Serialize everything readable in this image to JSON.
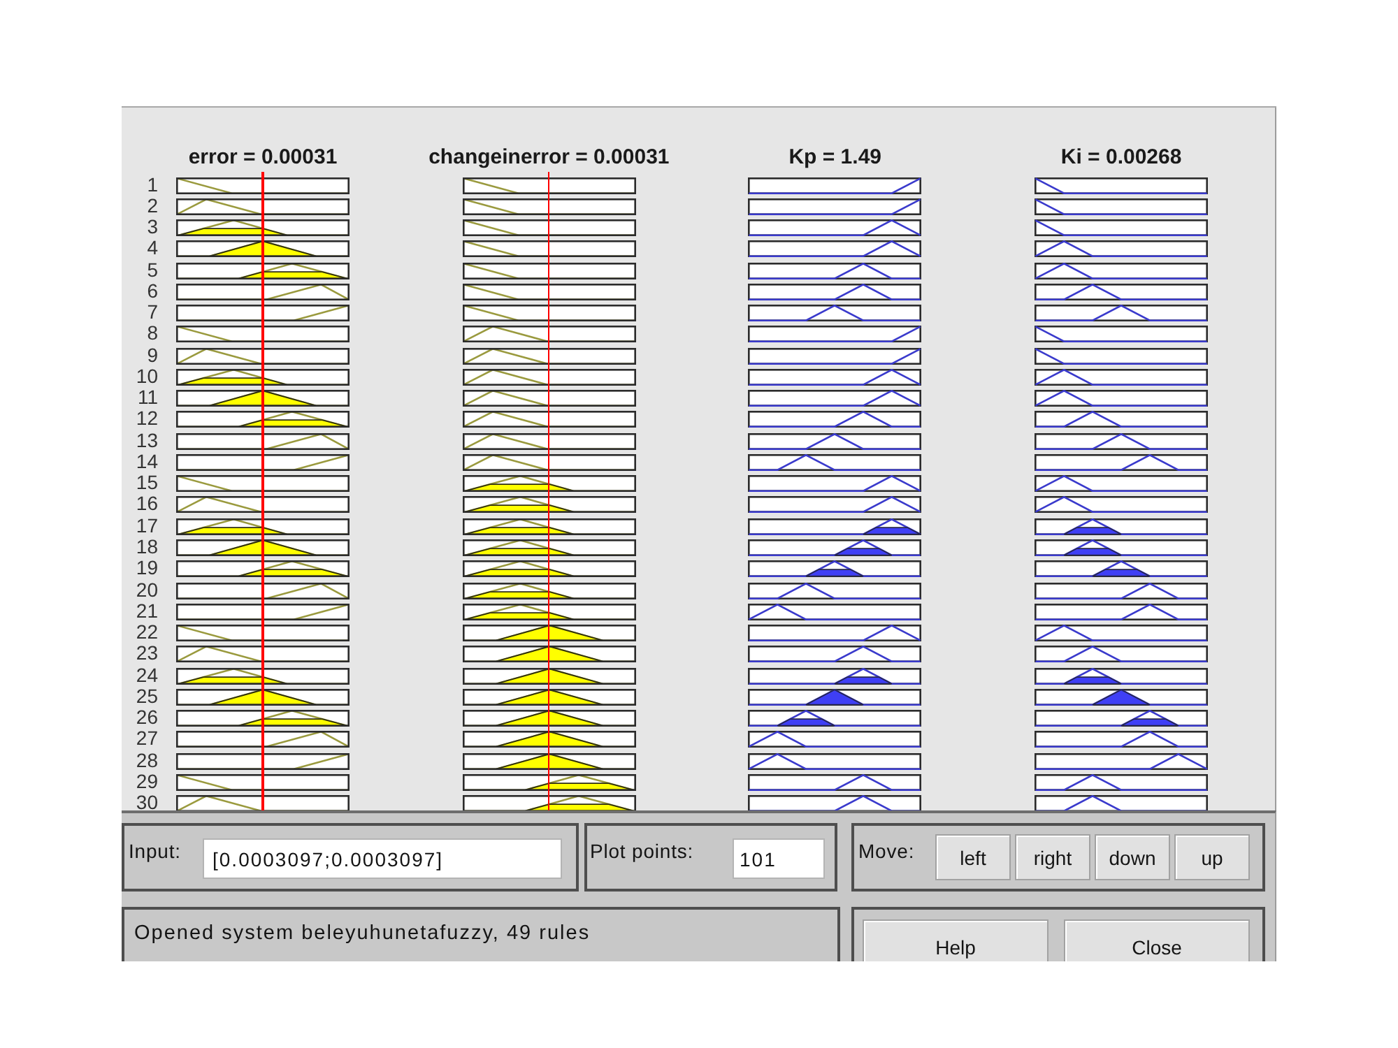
{
  "columns": [
    {
      "kind": "input",
      "title": "error = 0.00031",
      "level": 0.5
    },
    {
      "kind": "input",
      "title": "changeinerror = 0.00031",
      "level": 0.5
    },
    {
      "kind": "output",
      "title": "Kp = 1.49"
    },
    {
      "kind": "output",
      "title": "Ki = 0.00268"
    }
  ],
  "rules": [
    {
      "number": "1",
      "cells": [
        {
          "kind": "mf1"
        },
        {
          "kind": "mf1"
        },
        {
          "kind": "mf7"
        },
        {
          "kind": "mf1"
        }
      ]
    },
    {
      "number": "2",
      "cells": [
        {
          "kind": "mf2"
        },
        {
          "kind": "mf1"
        },
        {
          "kind": "mf7"
        },
        {
          "kind": "mf1"
        }
      ]
    },
    {
      "number": "3",
      "cells": [
        {
          "kind": "mf3"
        },
        {
          "kind": "mf1"
        },
        {
          "kind": "mf6"
        },
        {
          "kind": "mf1"
        }
      ]
    },
    {
      "number": "4",
      "cells": [
        {
          "kind": "mf4"
        },
        {
          "kind": "mf1"
        },
        {
          "kind": "mf6"
        },
        {
          "kind": "mf2"
        }
      ]
    },
    {
      "number": "5",
      "cells": [
        {
          "kind": "mf5"
        },
        {
          "kind": "mf1"
        },
        {
          "kind": "mf5"
        },
        {
          "kind": "mf2"
        }
      ]
    },
    {
      "number": "6",
      "cells": [
        {
          "kind": "mf6"
        },
        {
          "kind": "mf1"
        },
        {
          "kind": "mf5"
        },
        {
          "kind": "mf3"
        }
      ]
    },
    {
      "number": "7",
      "cells": [
        {
          "kind": "mf7"
        },
        {
          "kind": "mf1"
        },
        {
          "kind": "mf4"
        },
        {
          "kind": "mf4"
        }
      ]
    },
    {
      "number": "8",
      "cells": [
        {
          "kind": "mf1"
        },
        {
          "kind": "mf2"
        },
        {
          "kind": "mf7"
        },
        {
          "kind": "mf1"
        }
      ]
    },
    {
      "number": "9",
      "cells": [
        {
          "kind": "mf2"
        },
        {
          "kind": "mf2"
        },
        {
          "kind": "mf7"
        },
        {
          "kind": "mf1"
        }
      ]
    },
    {
      "number": "10",
      "cells": [
        {
          "kind": "mf3"
        },
        {
          "kind": "mf2"
        },
        {
          "kind": "mf6"
        },
        {
          "kind": "mf2"
        }
      ]
    },
    {
      "number": "11",
      "cells": [
        {
          "kind": "mf4"
        },
        {
          "kind": "mf2"
        },
        {
          "kind": "mf6"
        },
        {
          "kind": "mf2"
        }
      ]
    },
    {
      "number": "12",
      "cells": [
        {
          "kind": "mf5"
        },
        {
          "kind": "mf2"
        },
        {
          "kind": "mf5"
        },
        {
          "kind": "mf3"
        }
      ]
    },
    {
      "number": "13",
      "cells": [
        {
          "kind": "mf6"
        },
        {
          "kind": "mf2"
        },
        {
          "kind": "mf4"
        },
        {
          "kind": "mf4"
        }
      ]
    },
    {
      "number": "14",
      "cells": [
        {
          "kind": "mf7"
        },
        {
          "kind": "mf2"
        },
        {
          "kind": "mf3"
        },
        {
          "kind": "mf5"
        }
      ]
    },
    {
      "number": "15",
      "cells": [
        {
          "kind": "mf1"
        },
        {
          "kind": "mf3"
        },
        {
          "kind": "mf6"
        },
        {
          "kind": "mf2"
        }
      ]
    },
    {
      "number": "16",
      "cells": [
        {
          "kind": "mf2"
        },
        {
          "kind": "mf3"
        },
        {
          "kind": "mf6"
        },
        {
          "kind": "mf2"
        }
      ]
    },
    {
      "number": "17",
      "cells": [
        {
          "kind": "mf3"
        },
        {
          "kind": "mf3"
        },
        {
          "kind": "mf6"
        },
        {
          "kind": "mf3"
        }
      ]
    },
    {
      "number": "18",
      "cells": [
        {
          "kind": "mf4"
        },
        {
          "kind": "mf3"
        },
        {
          "kind": "mf5"
        },
        {
          "kind": "mf3"
        }
      ]
    },
    {
      "number": "19",
      "cells": [
        {
          "kind": "mf5"
        },
        {
          "kind": "mf3"
        },
        {
          "kind": "mf4"
        },
        {
          "kind": "mf4"
        }
      ]
    },
    {
      "number": "20",
      "cells": [
        {
          "kind": "mf6"
        },
        {
          "kind": "mf3"
        },
        {
          "kind": "mf3"
        },
        {
          "kind": "mf5"
        }
      ]
    },
    {
      "number": "21",
      "cells": [
        {
          "kind": "mf7"
        },
        {
          "kind": "mf3"
        },
        {
          "kind": "mf2"
        },
        {
          "kind": "mf5"
        }
      ]
    },
    {
      "number": "22",
      "cells": [
        {
          "kind": "mf1"
        },
        {
          "kind": "mf4"
        },
        {
          "kind": "mf6"
        },
        {
          "kind": "mf2"
        }
      ]
    },
    {
      "number": "23",
      "cells": [
        {
          "kind": "mf2"
        },
        {
          "kind": "mf4"
        },
        {
          "kind": "mf5"
        },
        {
          "kind": "mf3"
        }
      ]
    },
    {
      "number": "24",
      "cells": [
        {
          "kind": "mf3"
        },
        {
          "kind": "mf4"
        },
        {
          "kind": "mf5"
        },
        {
          "kind": "mf3"
        }
      ]
    },
    {
      "number": "25",
      "cells": [
        {
          "kind": "mf4"
        },
        {
          "kind": "mf4"
        },
        {
          "kind": "mf4"
        },
        {
          "kind": "mf4"
        }
      ]
    },
    {
      "number": "26",
      "cells": [
        {
          "kind": "mf5"
        },
        {
          "kind": "mf4"
        },
        {
          "kind": "mf3"
        },
        {
          "kind": "mf5"
        }
      ]
    },
    {
      "number": "27",
      "cells": [
        {
          "kind": "mf6"
        },
        {
          "kind": "mf4"
        },
        {
          "kind": "mf2"
        },
        {
          "kind": "mf5"
        }
      ]
    },
    {
      "number": "28",
      "cells": [
        {
          "kind": "mf7"
        },
        {
          "kind": "mf4"
        },
        {
          "kind": "mf2"
        },
        {
          "kind": "mf6"
        }
      ]
    },
    {
      "number": "29",
      "cells": [
        {
          "kind": "mf1"
        },
        {
          "kind": "mf5"
        },
        {
          "kind": "mf5"
        },
        {
          "kind": "mf3"
        }
      ]
    },
    {
      "number": "30",
      "cells": [
        {
          "kind": "mf2"
        },
        {
          "kind": "mf5"
        },
        {
          "kind": "mf5"
        },
        {
          "kind": "mf3"
        }
      ]
    }
  ],
  "input": {
    "label": "Input:",
    "value": "[0.0003097;0.0003097]"
  },
  "plot_points": {
    "label": "Plot points:",
    "value": "101"
  },
  "move": {
    "label": "Move:",
    "buttons": [
      "left",
      "right",
      "down",
      "up"
    ]
  },
  "status": "Opened system beleyuhunetafuzzy, 49 rules",
  "dialog_buttons": [
    "Help",
    "Close"
  ]
}
